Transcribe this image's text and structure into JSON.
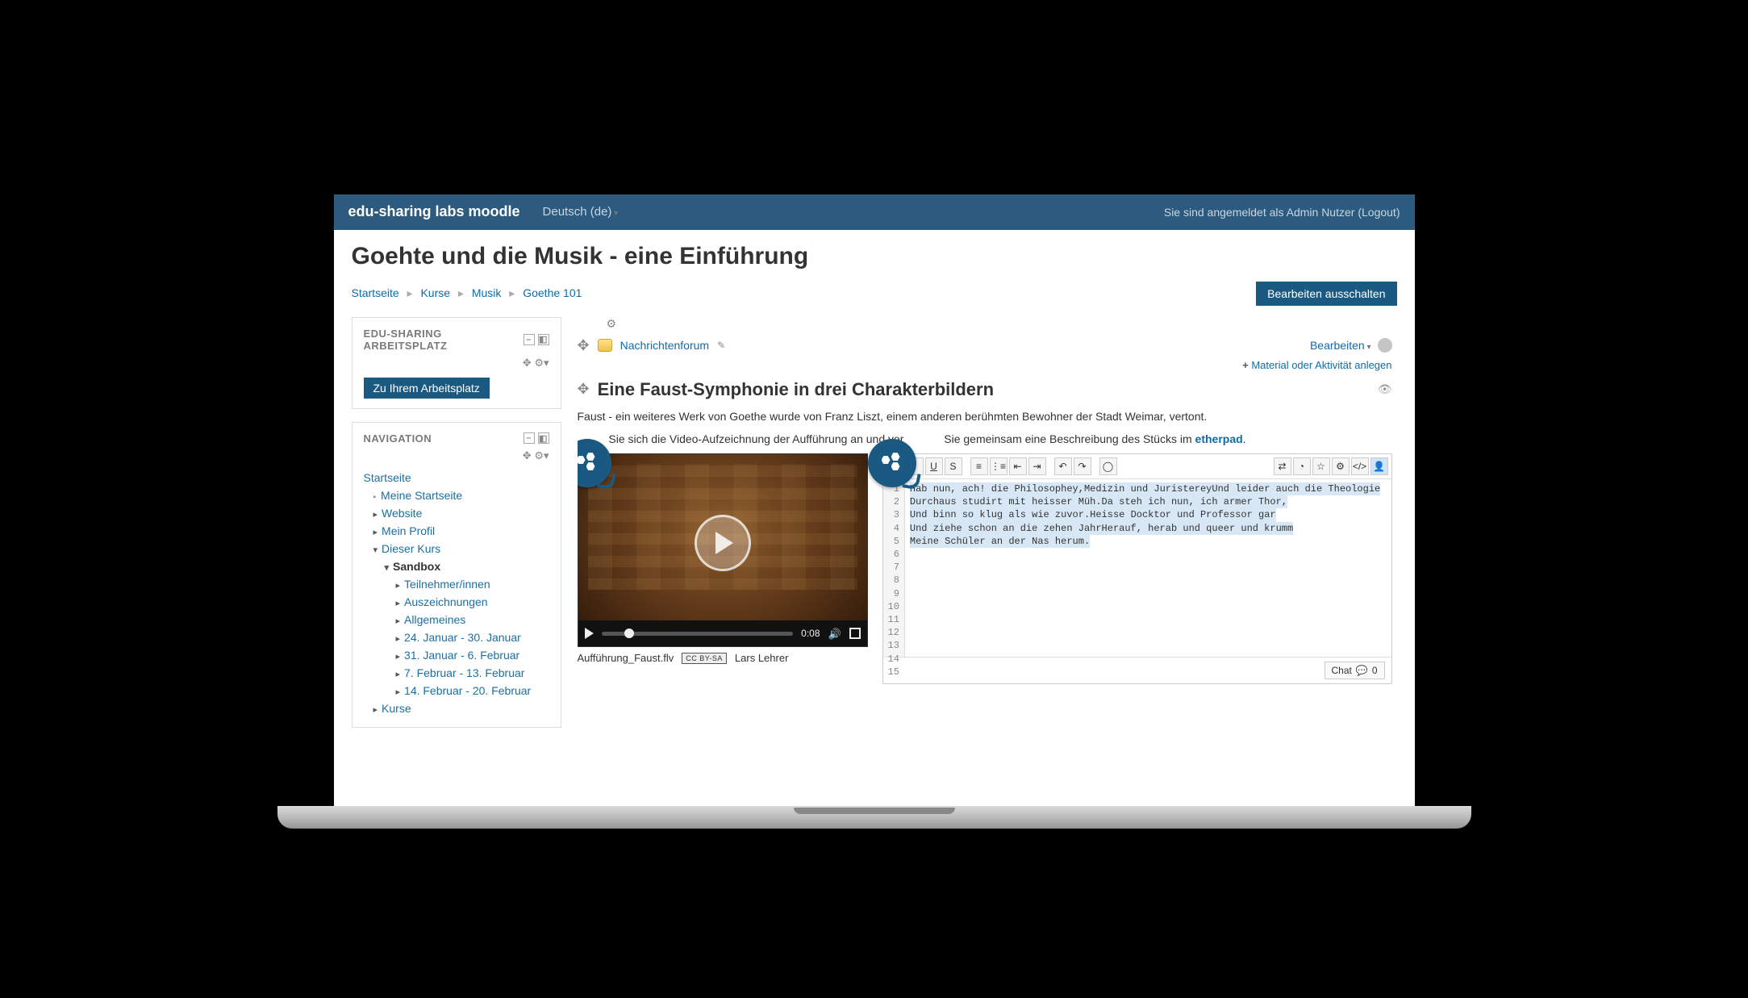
{
  "topbar": {
    "brand": "edu-sharing labs moodle",
    "language": "Deutsch (de)",
    "loggedin_prefix": "Sie sind angemeldet als ",
    "user": "Admin Nutzer",
    "logout": "Logout"
  },
  "page_title": "Goehte und die Musik - eine Einführung",
  "breadcrumb": [
    "Startseite",
    "Kurse",
    "Musik",
    "Goethe 101"
  ],
  "edit_button": "Bearbeiten ausschalten",
  "blocks": {
    "workspace_title": "EDU-SHARING ARBEITSPLATZ",
    "workspace_button": "Zu Ihrem Arbeitsplatz",
    "nav_title": "NAVIGATION"
  },
  "nav": {
    "root": "Startseite",
    "my": "Meine Startseite",
    "website": "Website",
    "profile": "Mein Profil",
    "thiscourse": "Dieser Kurs",
    "sandbox": "Sandbox",
    "participants": "Teilnehmer/innen",
    "badges": "Auszeichnungen",
    "general": "Allgemeines",
    "w1": "24. Januar - 30. Januar",
    "w2": "31. Januar - 6. Februar",
    "w3": "7. Februar - 13. Februar",
    "w4": "14. Februar - 20. Februar",
    "courses": "Kurse"
  },
  "section": {
    "forum_label": "Nachrichtenforum",
    "edit_label": "Bearbeiten",
    "add_label": "Material oder Aktivität anlegen",
    "title": "Eine Faust-Symphonie in drei Charakterbildern",
    "para1": "Faust - ein weiteres Werk von Goethe wurde von Franz Liszt, einem anderen berühmten Bewohner der Stadt Weimar, vertont.",
    "para2a": "Sie sich die Video-Aufzeichnung der Aufführung an und ver",
    "para2b": "Sie gemeinsam eine Beschreibung des Stücks im ",
    "para2_link": "etherpad"
  },
  "video": {
    "time": "0:08",
    "filename": "Aufführung_Faust.flv",
    "license": "CC BY-SA",
    "author": "Lars Lehrer"
  },
  "editor": {
    "lines": [
      "Hab nun, ach! die Philosophey,",
      "Medizin und Juristerey",
      "Und leider auch die Theologie",
      "Durchaus studirt mit heisser Müh.",
      "Da steh ich nun, ich armer Thor,",
      "Und binn so klug als wie zuvor.",
      "Heisse Docktor und Professor gar",
      "Und ziehe schon an die zehen Jahr",
      "Herauf, herab und queer und krumm",
      "Meine Schüler an der Nas herum."
    ],
    "total_lines": 15,
    "chat_label": "Chat",
    "chat_count": "0"
  }
}
